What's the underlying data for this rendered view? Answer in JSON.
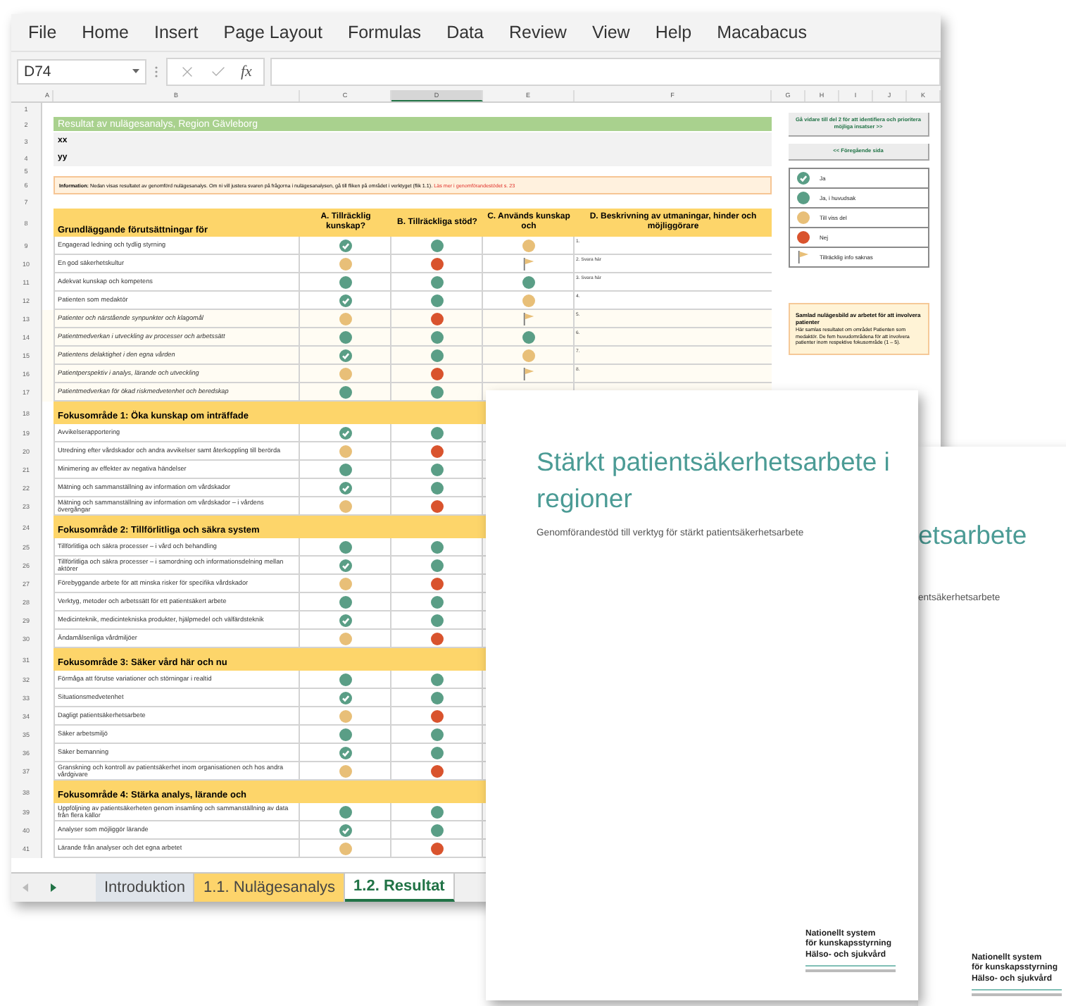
{
  "menu": [
    "File",
    "Home",
    "Insert",
    "Page Layout",
    "Formulas",
    "Data",
    "Review",
    "View",
    "Help",
    "Macabacus"
  ],
  "formula_bar": {
    "name_box": "D74",
    "function_label": "fx"
  },
  "columns": [
    {
      "label": "A",
      "selected": false
    },
    {
      "label": "B",
      "selected": false
    },
    {
      "label": "C",
      "selected": false
    },
    {
      "label": "D",
      "selected": true
    },
    {
      "label": "E",
      "selected": false
    },
    {
      "label": "F",
      "selected": false
    },
    {
      "label": "G",
      "selected": false
    },
    {
      "label": "H",
      "selected": false
    },
    {
      "label": "I",
      "selected": false
    },
    {
      "label": "J",
      "selected": false
    },
    {
      "label": "K",
      "selected": false
    }
  ],
  "rows": [
    {
      "row": "1",
      "kind": "blank"
    },
    {
      "row": "2",
      "kind": "title",
      "text": "Resultat av nulägesanalys, Region Gävleborg"
    },
    {
      "row": "3",
      "kind": "note",
      "text": "xx"
    },
    {
      "row": "4",
      "kind": "note",
      "text": "yy"
    },
    {
      "row": "5",
      "kind": "gap"
    },
    {
      "row": "6",
      "kind": "info",
      "label": "Information:",
      "text": "Nedan visas resultatet av genomförd nulägesanalys. Om ni vill justera svaren på frågorna i nulägesanalysen, gå till fliken på området i verktyget (flik 1.1).",
      "link": "Läs mer i genomförandestödet s. 23"
    },
    {
      "row": "7",
      "kind": "blank"
    },
    {
      "row": "8",
      "kind": "header",
      "text": "Grundläggande förutsättningar för",
      "columns": [
        "A. Tillräcklig kunskap?",
        "B. Tillräckliga stöd?",
        "C. Används kunskap och",
        "D. Beskrivning av utmaningar, hinder och möjliggörare"
      ]
    },
    {
      "row": "9",
      "kind": "item",
      "text": "Engagerad ledning och tydlig styrning",
      "marks": [
        {
          "kind": "check"
        },
        {
          "kind": "green"
        },
        {
          "kind": "tan"
        }
      ],
      "d": "1."
    },
    {
      "row": "10",
      "kind": "item",
      "text": "En god säkerhetskultur",
      "marks": [
        {
          "kind": "tan"
        },
        {
          "kind": "red"
        },
        {
          "kind": "flag"
        }
      ],
      "d": "2. Svara här"
    },
    {
      "row": "11",
      "kind": "item",
      "text": "Adekvat kunskap och kompetens",
      "marks": [
        {
          "kind": "green"
        },
        {
          "kind": "green"
        },
        {
          "kind": "green"
        }
      ],
      "d": "3. Svara här"
    },
    {
      "row": "12",
      "kind": "item",
      "text": "Patienten som medaktör",
      "marks": [
        {
          "kind": "check"
        },
        {
          "kind": "green"
        },
        {
          "kind": "tan"
        }
      ],
      "d": "4."
    },
    {
      "row": "13",
      "kind": "subitem",
      "text": "Patienter och närstående synpunkter och klagomål",
      "marks": [
        {
          "kind": "tan"
        },
        {
          "kind": "red"
        },
        {
          "kind": "flag"
        }
      ],
      "d": "5."
    },
    {
      "row": "14",
      "kind": "subitem",
      "text": "Patientmedverkan i utveckling av processer och arbetssätt",
      "marks": [
        {
          "kind": "green"
        },
        {
          "kind": "green"
        },
        {
          "kind": "green"
        }
      ],
      "d": "6."
    },
    {
      "row": "15",
      "kind": "subitem",
      "text": "Patientens delaktighet i den egna vården",
      "marks": [
        {
          "kind": "check"
        },
        {
          "kind": "green"
        },
        {
          "kind": "tan"
        }
      ],
      "d": "7."
    },
    {
      "row": "16",
      "kind": "subitem",
      "text": "Patientperspektiv i analys, lärande och utveckling",
      "marks": [
        {
          "kind": "tan"
        },
        {
          "kind": "red"
        },
        {
          "kind": "flag"
        }
      ],
      "d": "8."
    },
    {
      "row": "17",
      "kind": "subitem",
      "text": "Patientmedverkan för ökad riskmedvetenhet och beredskap",
      "marks": [
        {
          "kind": "green"
        },
        {
          "kind": "green"
        }
      ]
    },
    {
      "row": "18",
      "kind": "section",
      "text": "Fokusområde 1: Öka kunskap om inträffade"
    },
    {
      "row": "19",
      "kind": "item",
      "text": "Avvikelserapportering",
      "marks": [
        {
          "kind": "check"
        },
        {
          "kind": "green"
        }
      ]
    },
    {
      "row": "20",
      "kind": "item",
      "text": "Utredning efter vårdskador och andra avvikelser samt återkoppling till berörda",
      "marks": [
        {
          "kind": "tan"
        },
        {
          "kind": "red"
        }
      ]
    },
    {
      "row": "21",
      "kind": "item",
      "text": "Minimering av effekter av negativa händelser",
      "marks": [
        {
          "kind": "green"
        },
        {
          "kind": "green"
        }
      ]
    },
    {
      "row": "22",
      "kind": "item",
      "text": "Mätning och sammanställning av information om vårdskador",
      "marks": [
        {
          "kind": "check"
        },
        {
          "kind": "green"
        }
      ]
    },
    {
      "row": "23",
      "kind": "item",
      "text": "Mätning och sammanställning av information om vårdskador – i vårdens övergångar",
      "marks": [
        {
          "kind": "tan"
        },
        {
          "kind": "red"
        }
      ]
    },
    {
      "row": "24",
      "kind": "section",
      "text": "Fokusområde 2: Tillförlitliga och säkra system"
    },
    {
      "row": "25",
      "kind": "item",
      "text": "Tillförlitliga och säkra processer – i vård och behandling",
      "marks": [
        {
          "kind": "green"
        },
        {
          "kind": "green"
        }
      ]
    },
    {
      "row": "26",
      "kind": "item",
      "text": "Tillförlitliga och säkra processer – i samordning och informationsdelning mellan aktörer",
      "marks": [
        {
          "kind": "check"
        },
        {
          "kind": "green"
        }
      ]
    },
    {
      "row": "27",
      "kind": "item",
      "text": "Förebyggande arbete för att minska risker för specifika vårdskador",
      "marks": [
        {
          "kind": "tan"
        },
        {
          "kind": "red"
        }
      ]
    },
    {
      "row": "28",
      "kind": "item",
      "text": "Verktyg, metoder och arbetssätt för ett patientsäkert arbete",
      "marks": [
        {
          "kind": "green"
        },
        {
          "kind": "green"
        }
      ]
    },
    {
      "row": "29",
      "kind": "item",
      "text": "Medicinteknik, medicintekniska produkter, hjälpmedel och välfärdsteknik",
      "marks": [
        {
          "kind": "check"
        },
        {
          "kind": "green"
        }
      ]
    },
    {
      "row": "30",
      "kind": "item",
      "text": "Ändamålsenliga vårdmiljöer",
      "marks": [
        {
          "kind": "tan"
        },
        {
          "kind": "red"
        }
      ]
    },
    {
      "row": "31",
      "kind": "section",
      "text": "Fokusområde 3: Säker vård här och nu"
    },
    {
      "row": "32",
      "kind": "item",
      "text": "Förmåga att förutse variationer och störningar i realtid",
      "marks": [
        {
          "kind": "green"
        },
        {
          "kind": "green"
        }
      ]
    },
    {
      "row": "33",
      "kind": "item",
      "text": "Situationsmedvetenhet",
      "marks": [
        {
          "kind": "check"
        },
        {
          "kind": "green"
        }
      ]
    },
    {
      "row": "34",
      "kind": "item",
      "text": "Dagligt patientsäkerhetsarbete",
      "marks": [
        {
          "kind": "tan"
        },
        {
          "kind": "red"
        }
      ]
    },
    {
      "row": "35",
      "kind": "item",
      "text": "Säker arbetsmiljö",
      "marks": [
        {
          "kind": "green"
        },
        {
          "kind": "green"
        }
      ]
    },
    {
      "row": "36",
      "kind": "item",
      "text": "Säker bemanning",
      "marks": [
        {
          "kind": "check"
        },
        {
          "kind": "green"
        }
      ]
    },
    {
      "row": "37",
      "kind": "item",
      "text": "Granskning och kontroll av patientsäkerhet inom organisationen och hos andra vårdgivare",
      "marks": [
        {
          "kind": "tan"
        },
        {
          "kind": "red"
        }
      ]
    },
    {
      "row": "38",
      "kind": "section",
      "text": "Fokusområde 4: Stärka analys, lärande och"
    },
    {
      "row": "39",
      "kind": "item",
      "text": "Uppföljning av patientsäkerheten genom insamling och sammanställning av data från flera källor",
      "marks": [
        {
          "kind": "green"
        },
        {
          "kind": "green"
        }
      ]
    },
    {
      "row": "40",
      "kind": "item",
      "text": "Analyser som möjliggör lärande",
      "marks": [
        {
          "kind": "check"
        },
        {
          "kind": "green"
        }
      ]
    },
    {
      "row": "41",
      "kind": "item",
      "text": "Lärande från analyser och det egna arbetet",
      "marks": [
        {
          "kind": "tan"
        },
        {
          "kind": "red"
        }
      ]
    }
  ],
  "side_panel": {
    "next_button": "Gå vidare till del 2 för att identifiera och prioritera möjliga insatser >>",
    "back_button": "<< Föregående sida",
    "legend": [
      {
        "kind": "check",
        "label": "Ja"
      },
      {
        "kind": "green",
        "label": "Ja, i huvudsak"
      },
      {
        "kind": "tan",
        "label": "Till viss del"
      },
      {
        "kind": "red",
        "label": "Nej"
      },
      {
        "kind": "flag",
        "label": "Tillräcklig info saknas"
      }
    ],
    "summary_title": "Samlad nulägesbild av arbetet för att involvera patienter",
    "summary_text": "Här samlas resultatet om området Patienten som medaktör. De fem huvudområdena för att involvera patienter inom respektive fokusområde (1 – 5)."
  },
  "sheet_tabs": [
    {
      "label": "Introduktion",
      "color": "#dfe4ea",
      "selected": false
    },
    {
      "label": "1.1. Nulägesanalys",
      "color": "#fdd46b",
      "selected": false
    },
    {
      "label": "1.2. Resultat",
      "color": "#ffffff",
      "selected": true
    }
  ],
  "front_page": {
    "title": "Stärkt patientsäkerhetsarbete i regioner",
    "subtitle": "Genomförandestöd till verktyg för stärkt patientsäkerhetsarbete",
    "logo": [
      "Nationellt system",
      "för kunskapsstyrning",
      "Hälso- och sjukvård"
    ]
  },
  "back_page": {
    "title": "etsarbete",
    "subtitle": "entsäkerhetsarbete",
    "logo": [
      "Nationellt system",
      "för kunskapsstyrning",
      "Hälso- och sjukvård"
    ]
  }
}
